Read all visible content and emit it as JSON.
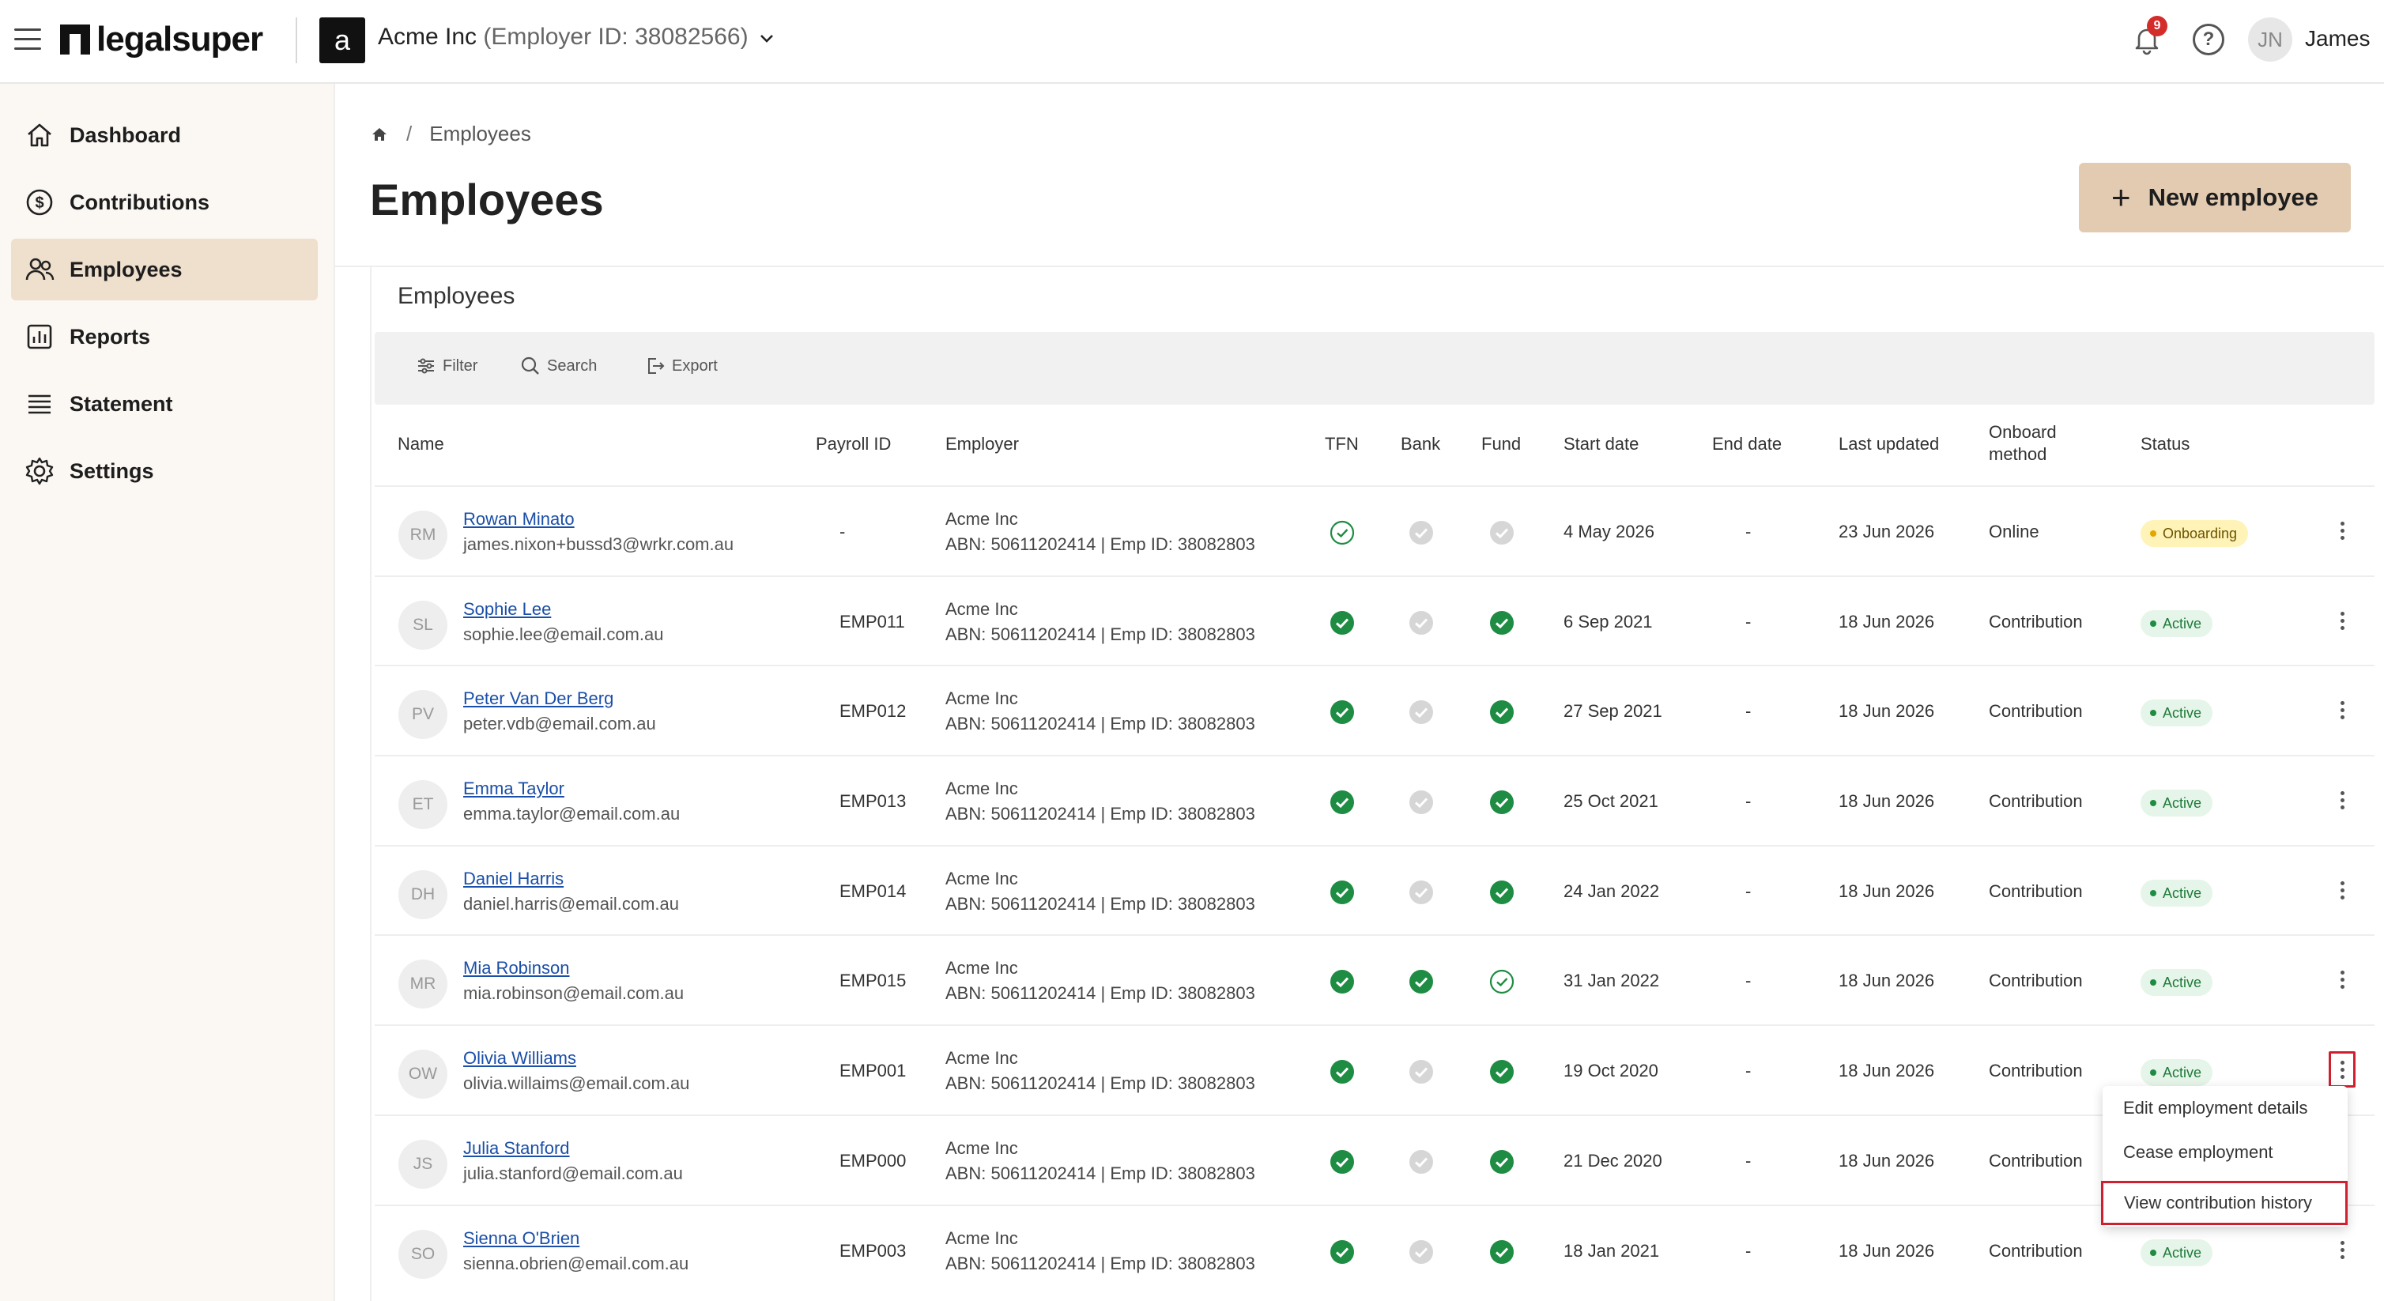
{
  "brand": {
    "name": "legalsuper"
  },
  "employer": {
    "avatar_letter": "a",
    "name": "Acme Inc",
    "id_text": "(Employer ID: 38082566)"
  },
  "notifications": {
    "count": "9"
  },
  "help": {
    "label": "?"
  },
  "user": {
    "initials": "JN",
    "name": "James"
  },
  "sidebar": {
    "items": [
      {
        "label": "Dashboard",
        "icon": "home-icon"
      },
      {
        "label": "Contributions",
        "icon": "dollar-icon"
      },
      {
        "label": "Employees",
        "icon": "users-icon",
        "active": true
      },
      {
        "label": "Reports",
        "icon": "chart-icon"
      },
      {
        "label": "Statement",
        "icon": "list-icon"
      },
      {
        "label": "Settings",
        "icon": "gear-icon"
      }
    ]
  },
  "breadcrumb": {
    "current": "Employees",
    "separator": "/"
  },
  "page": {
    "title": "Employees",
    "new_button": "New employee"
  },
  "card": {
    "title": "Employees"
  },
  "toolbar": {
    "filter": "Filter",
    "search": "Search",
    "export": "Export"
  },
  "table": {
    "headers": {
      "name": "Name",
      "payroll_id": "Payroll ID",
      "employer": "Employer",
      "tfn": "TFN",
      "bank": "Bank",
      "fund": "Fund",
      "start_date": "Start date",
      "end_date": "End date",
      "last_updated": "Last updated",
      "onboard_line1": "Onboard",
      "onboard_line2": "method",
      "status": "Status"
    },
    "rows": [
      {
        "initials": "RM",
        "name": "Rowan Minato",
        "email": "james.nixon+bussd3@wrkr.com.au",
        "payroll_id": "-",
        "employer": "Acme Inc",
        "employer_detail": "ABN: 50611202414 | Emp ID: 38082803",
        "tfn": "outline",
        "bank": "grey",
        "fund": "grey",
        "start_date": "4 May 2026",
        "end_date": "-",
        "last_updated": "23 Jun 2026",
        "onboard": "Online",
        "status": "Onboarding"
      },
      {
        "initials": "SL",
        "name": "Sophie Lee",
        "email": "sophie.lee@email.com.au",
        "payroll_id": "EMP011",
        "employer": "Acme Inc",
        "employer_detail": "ABN: 50611202414 | Emp ID: 38082803",
        "tfn": "filled",
        "bank": "grey",
        "fund": "filled",
        "start_date": "6 Sep 2021",
        "end_date": "-",
        "last_updated": "18 Jun 2026",
        "onboard": "Contribution",
        "status": "Active"
      },
      {
        "initials": "PV",
        "name": "Peter Van Der Berg",
        "email": "peter.vdb@email.com.au",
        "payroll_id": "EMP012",
        "employer": "Acme Inc",
        "employer_detail": "ABN: 50611202414 | Emp ID: 38082803",
        "tfn": "filled",
        "bank": "grey",
        "fund": "filled",
        "start_date": "27 Sep 2021",
        "end_date": "-",
        "last_updated": "18 Jun 2026",
        "onboard": "Contribution",
        "status": "Active"
      },
      {
        "initials": "ET",
        "name": "Emma Taylor",
        "email": "emma.taylor@email.com.au",
        "payroll_id": "EMP013",
        "employer": "Acme Inc",
        "employer_detail": "ABN: 50611202414 | Emp ID: 38082803",
        "tfn": "filled",
        "bank": "grey",
        "fund": "filled",
        "start_date": "25 Oct 2021",
        "end_date": "-",
        "last_updated": "18 Jun 2026",
        "onboard": "Contribution",
        "status": "Active"
      },
      {
        "initials": "DH",
        "name": "Daniel Harris",
        "email": "daniel.harris@email.com.au",
        "payroll_id": "EMP014",
        "employer": "Acme Inc",
        "employer_detail": "ABN: 50611202414 | Emp ID: 38082803",
        "tfn": "filled",
        "bank": "grey",
        "fund": "filled",
        "start_date": "24 Jan 2022",
        "end_date": "-",
        "last_updated": "18 Jun 2026",
        "onboard": "Contribution",
        "status": "Active"
      },
      {
        "initials": "MR",
        "name": "Mia Robinson",
        "email": "mia.robinson@email.com.au",
        "payroll_id": "EMP015",
        "employer": "Acme Inc",
        "employer_detail": "ABN: 50611202414 | Emp ID: 38082803",
        "tfn": "filled",
        "bank": "filled",
        "fund": "outline",
        "start_date": "31 Jan 2022",
        "end_date": "-",
        "last_updated": "18 Jun 2026",
        "onboard": "Contribution",
        "status": "Active"
      },
      {
        "initials": "OW",
        "name": "Olivia Williams",
        "email": "olivia.willaims@email.com.au",
        "payroll_id": "EMP001",
        "employer": "Acme Inc",
        "employer_detail": "ABN: 50611202414 | Emp ID: 38082803",
        "tfn": "filled",
        "bank": "grey",
        "fund": "filled",
        "start_date": "19 Oct 2020",
        "end_date": "-",
        "last_updated": "18 Jun 2026",
        "onboard": "Contribution",
        "status": "Active"
      },
      {
        "initials": "JS",
        "name": "Julia Stanford",
        "email": "julia.stanford@email.com.au",
        "payroll_id": "EMP000",
        "employer": "Acme Inc",
        "employer_detail": "ABN: 50611202414 | Emp ID: 38082803",
        "tfn": "filled",
        "bank": "grey",
        "fund": "filled",
        "start_date": "21 Dec 2020",
        "end_date": "-",
        "last_updated": "18 Jun 2026",
        "onboard": "Contribution",
        "status": ""
      },
      {
        "initials": "SO",
        "name": "Sienna O'Brien",
        "email": "sienna.obrien@email.com.au",
        "payroll_id": "EMP003",
        "employer": "Acme Inc",
        "employer_detail": "ABN: 50611202414 | Emp ID: 38082803",
        "tfn": "filled",
        "bank": "grey",
        "fund": "filled",
        "start_date": "18 Jan 2021",
        "end_date": "-",
        "last_updated": "18 Jun 2026",
        "onboard": "Contribution",
        "status": "Active"
      }
    ]
  },
  "row_menu": {
    "items": [
      "Edit employment details",
      "Cease employment",
      "View contribution history"
    ],
    "highlighted": "View contribution history"
  },
  "colors": {
    "accent": "#e3cbb2",
    "sidebar_active": "#efdfcd",
    "success": "#1e8c43",
    "highlight": "#d0202f",
    "link": "#1a4ea8"
  }
}
